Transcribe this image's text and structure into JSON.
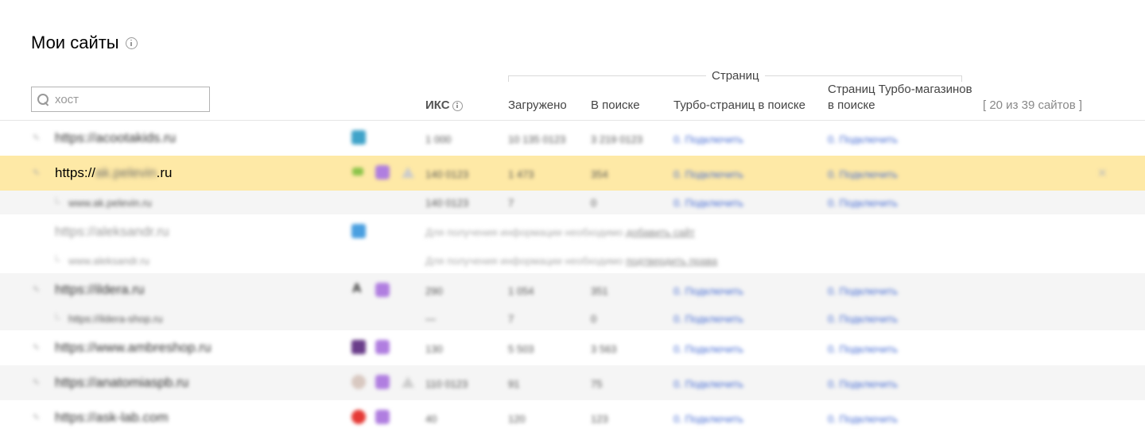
{
  "page": {
    "title": "Мои сайты",
    "search_placeholder": "хост"
  },
  "table_header": {
    "iks": "ИКС",
    "pages_group": "Страниц",
    "loaded": "Загружено",
    "in_search": "В поиске",
    "turbo_in_search": "Турбо-страниц в поиске",
    "shop_turbo": "Страниц Турбо-магазинов в поиске",
    "counter": "[ 20 из 39 сайтов ]"
  },
  "rows": [
    {
      "host": "https://acootakids.ru",
      "iks": "1 000",
      "loaded": "10 135 0123",
      "in_search": "3 219 0123",
      "turbo": "0. Подключить",
      "shop": "0. Подключить"
    },
    {
      "host_prefix": "https://",
      "host_hidden": "ak.pelevin",
      "host_suffix": ".ru",
      "iks": "140 0123",
      "loaded": "1 473",
      "in_search": "354",
      "turbo": "0. Подключить",
      "shop": "0. Подключить"
    },
    {
      "host": "www.ak.pelevin.ru",
      "iks": "140 0123",
      "loaded": "7",
      "in_search": "0",
      "turbo": "0. Подключить",
      "shop": "0. Подключить"
    },
    {
      "host": "https://aleksandr.ru",
      "note": "Для получения информации необходимо",
      "note_link": "добавить сайт"
    },
    {
      "host": "www.aleksandr.ru",
      "note": "Для получения информации необходимо",
      "note_link": "подтвердить права"
    },
    {
      "host": "https://ildera.ru",
      "iks": "290",
      "loaded": "1 054",
      "in_search": "351",
      "turbo": "0. Подключить",
      "shop": "0. Подключить"
    },
    {
      "host": "https://ildera-shop.ru",
      "iks": "—",
      "loaded": "7",
      "in_search": "0",
      "turbo": "0. Подключить",
      "shop": "0. Подключить"
    },
    {
      "host": "https://www.ambreshop.ru",
      "iks": "130",
      "loaded": "5 503",
      "in_search": "3 563",
      "turbo": "0. Подключить",
      "shop": "0. Подключить"
    },
    {
      "host": "https://anatomiaspb.ru",
      "iks": "110 0123",
      "loaded": "91",
      "in_search": "75",
      "turbo": "0. Подключить",
      "shop": "0. Подключить"
    },
    {
      "host": "https://ask-lab.com",
      "iks": "40",
      "loaded": "120",
      "in_search": "123",
      "turbo": "0. Подключить",
      "shop": "0. Подключить"
    }
  ],
  "colors": {
    "highlight": "#fee9a6",
    "stripe": "#f5f5f5",
    "link": "#4a6fd4"
  }
}
